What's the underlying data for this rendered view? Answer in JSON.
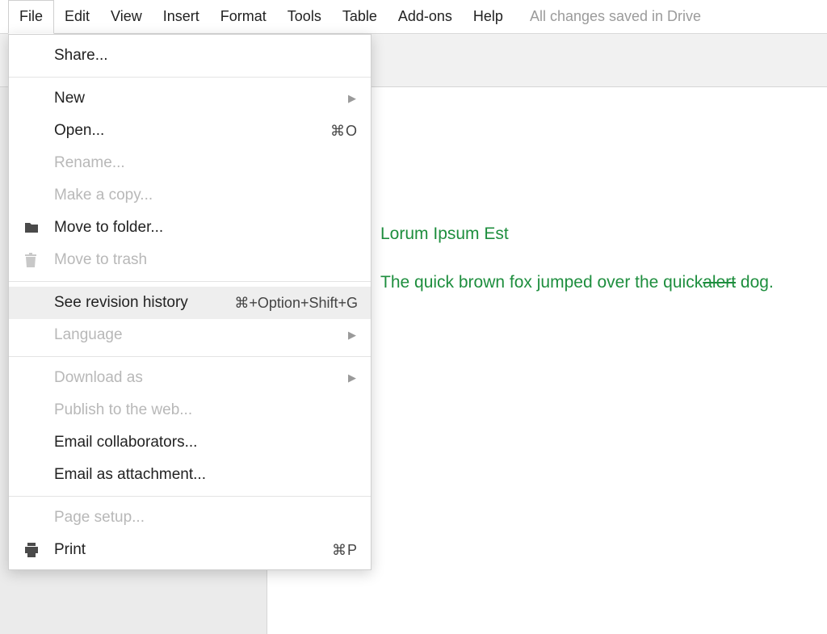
{
  "menubar": {
    "items": [
      "File",
      "Edit",
      "View",
      "Insert",
      "Format",
      "Tools",
      "Table",
      "Add-ons",
      "Help"
    ],
    "status": "All changes saved in Drive"
  },
  "file_menu": {
    "share": "Share...",
    "new": "New",
    "open": "Open...",
    "open_shortcut": "⌘O",
    "rename": "Rename...",
    "make_copy": "Make a copy...",
    "move_to_folder": "Move to folder...",
    "move_to_trash": "Move to trash",
    "see_revision_history": "See revision history",
    "see_revision_history_shortcut": "⌘+Option+Shift+G",
    "language": "Language",
    "download_as": "Download as",
    "publish_to_web": "Publish to the web...",
    "email_collaborators": "Email collaborators...",
    "email_as_attachment": "Email as attachment...",
    "page_setup": "Page setup...",
    "print": "Print",
    "print_shortcut": "⌘P"
  },
  "document": {
    "title_line": "Lorum Ipsum Est",
    "body_prefix": "The quick brown fox jumped over the quick",
    "body_strike": "alert",
    "body_suffix": " dog.",
    "text_color": "#1e8e3e"
  }
}
